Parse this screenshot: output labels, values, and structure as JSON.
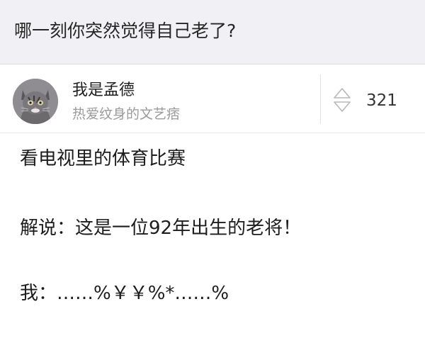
{
  "question": {
    "title": "哪一刻你突然觉得自己老了?"
  },
  "author": {
    "avatar_icon": "cat-avatar-icon",
    "name": "我是孟德",
    "bio": "热爱纹身的文艺痞"
  },
  "vote": {
    "icon": "up-down-vote-icon",
    "count": "321"
  },
  "answer": {
    "lines": [
      "看电视里的体育比赛",
      "解说：这是一位92年出生的老将！",
      "我：……%￥￥%*……%"
    ]
  }
}
